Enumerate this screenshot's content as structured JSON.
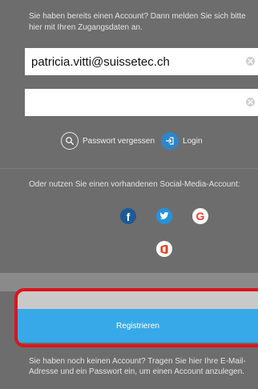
{
  "login": {
    "intro": "Sie haben bereits einen Account? Dann melden Sie sich bitte hier mit Ihren Zugangsdaten an.",
    "email_value": "patricia.vitti@suissetec.ch",
    "password_value": "",
    "forgot_label": "Passwort vergessen",
    "login_label": "Login"
  },
  "social": {
    "text": "Oder nutzen Sie einen vorhandenen Social-Media-Account:",
    "providers": [
      {
        "icon": "facebook-icon",
        "color": "#1c5996"
      },
      {
        "icon": "twitter-icon",
        "color": "#2493dc"
      },
      {
        "icon": "google-icon",
        "color": "#e74130"
      },
      {
        "icon": "office-icon",
        "color": "#e4411f"
      }
    ]
  },
  "register": {
    "button_label": "Registrieren",
    "text": "Sie haben noch keinen Account? Tragen Sie hier Ihre E-Mail-Adresse und ein Passwort ein, um einen Account anzulegen."
  },
  "colors": {
    "background": "#6d6d6d",
    "accent": "#38a9e8",
    "login_icon": "#2d86c8",
    "highlight": "#d9161e"
  }
}
